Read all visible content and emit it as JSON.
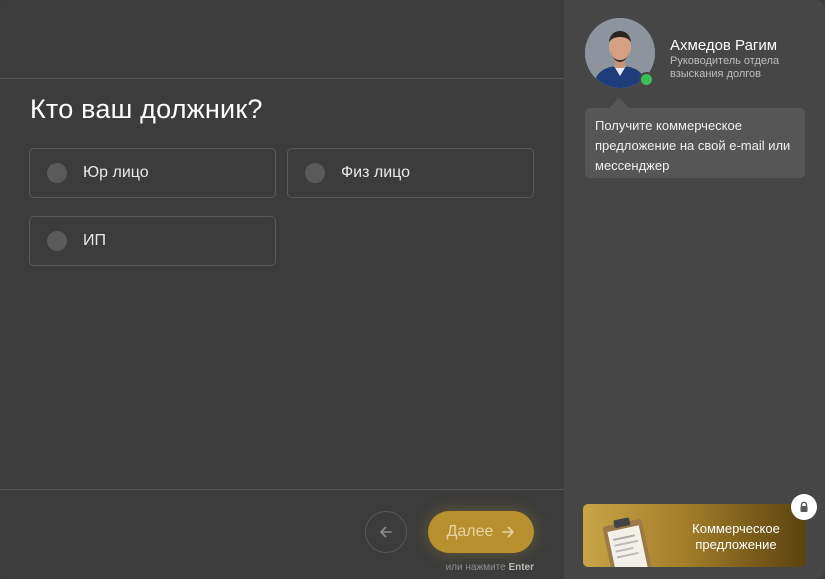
{
  "quiz": {
    "question": "Кто ваш должник?",
    "options": [
      {
        "label": "Юр лицо"
      },
      {
        "label": "Физ лицо"
      },
      {
        "label": "ИП"
      }
    ],
    "next_label": "Далее",
    "hint_prefix": "или нажмите",
    "hint_key": "Enter"
  },
  "manager": {
    "name": "Ахмедов Рагим",
    "role": "Руководитель отдела взыскания долгов",
    "message": "Получите коммерческое предложение на свой e-mail или мессенджер"
  },
  "offer": {
    "label": "Коммерческое предложение"
  },
  "icons": {
    "back": "arrow-left-icon",
    "next": "arrow-right-icon",
    "lock": "lock-icon",
    "offer": "clipboard-icon"
  },
  "colors": {
    "accent": "#b8902e",
    "online": "#3bbd5a",
    "background": "#3c3c3c",
    "sidebar": "#464646"
  }
}
